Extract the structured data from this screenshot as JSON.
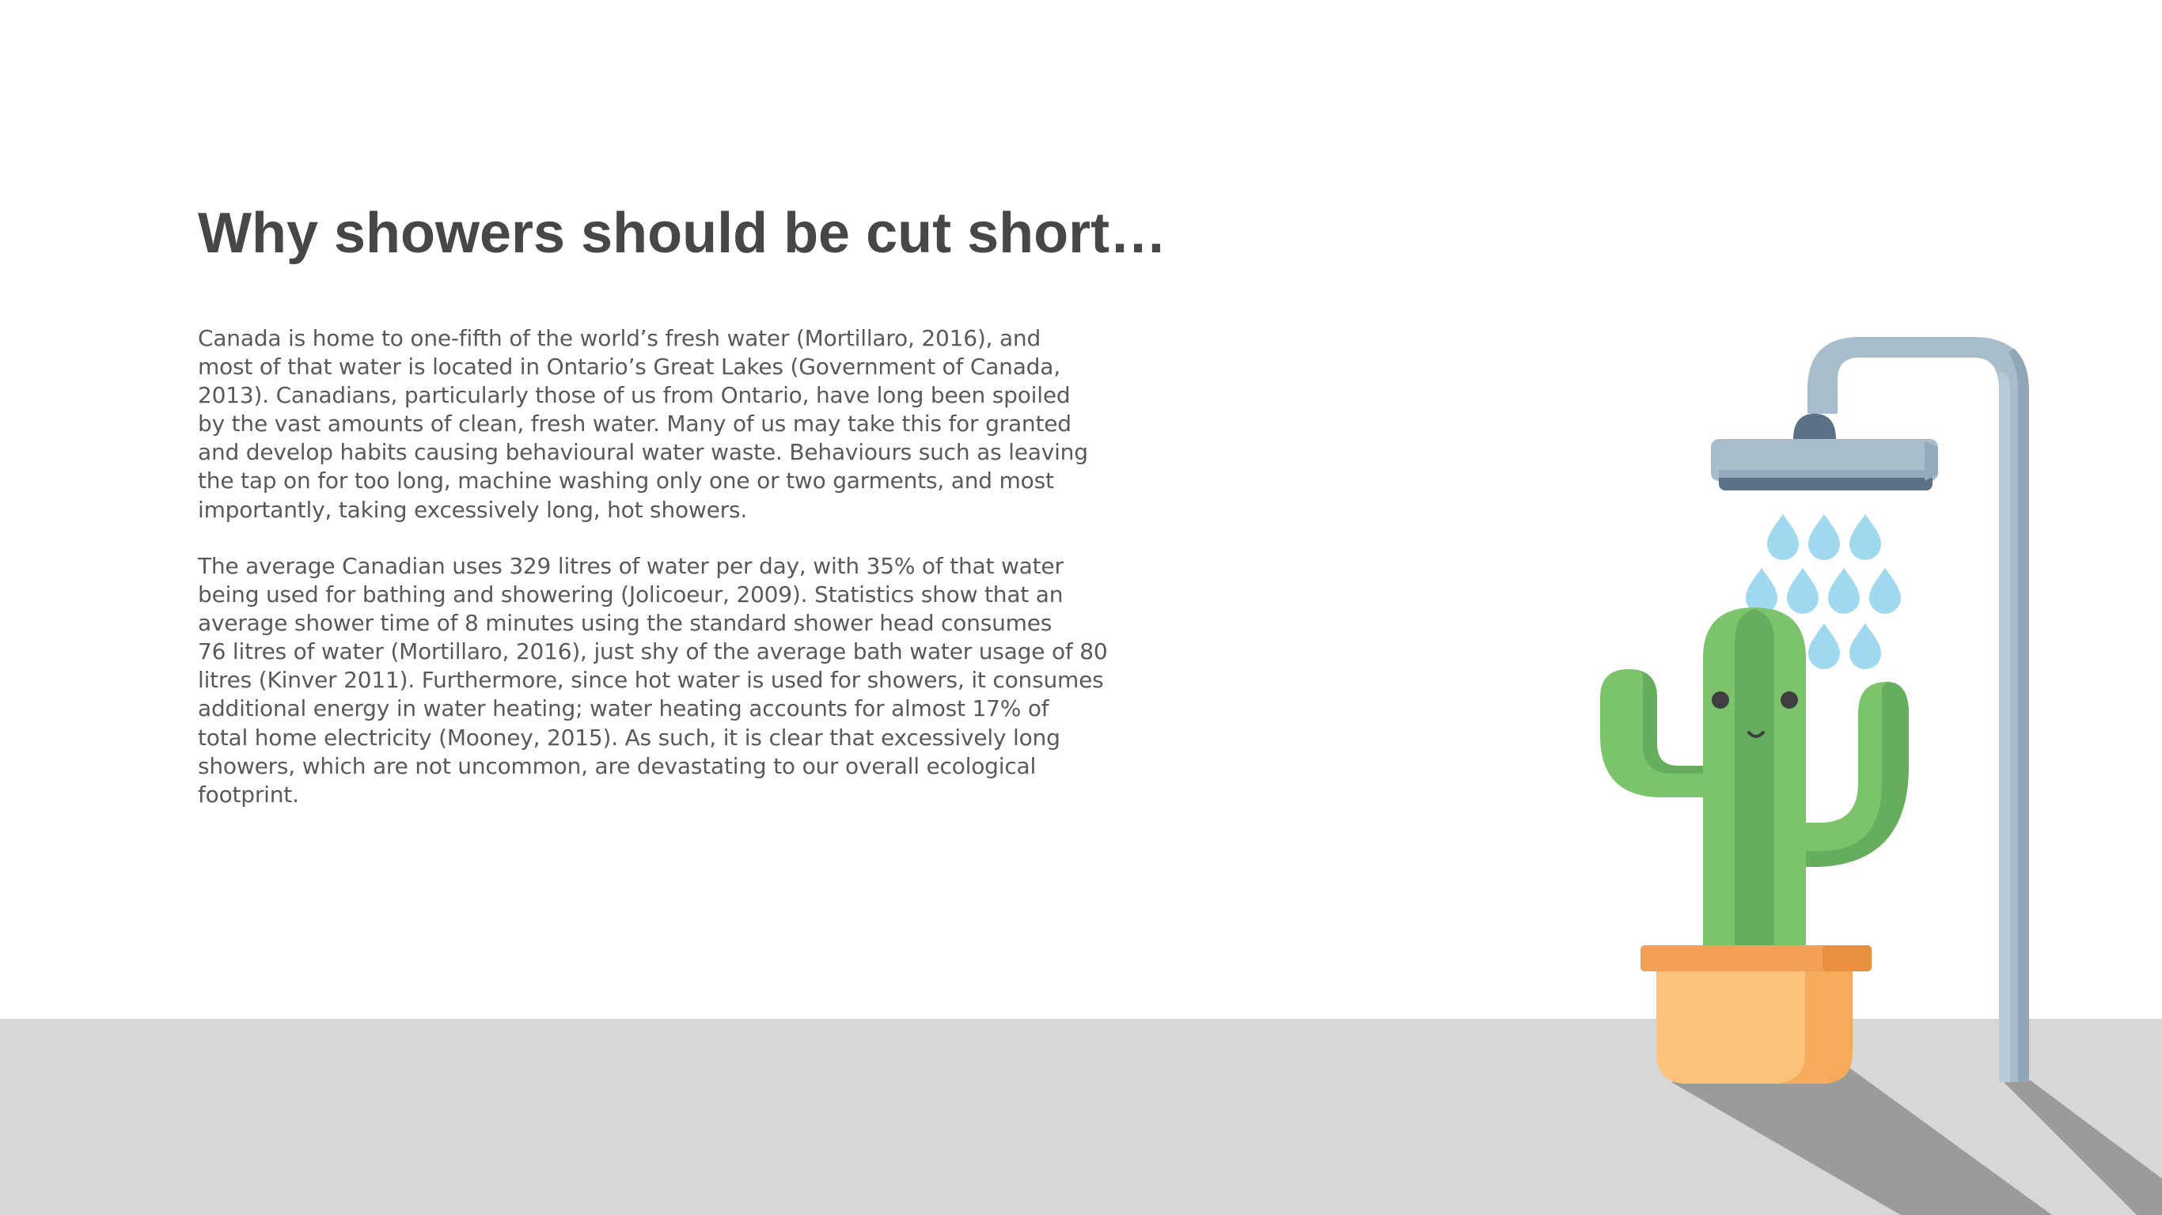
{
  "slide": {
    "title": "Why showers should be cut short…",
    "paragraph_1": [
      "Canada is home to one-fifth of the world’s fresh water (Mortillaro, 2016), and",
      "most of that water is located in Ontario’s Great Lakes (Government of Canada,",
      "2013). Canadians, particularly those of us from Ontario, have long been spoiled",
      "by the vast amounts of clean, fresh water. Many of us may take this for granted",
      "and develop habits causing behavioural water waste. Behaviours such as leaving",
      "the tap on for too long, machine washing only one or two garments, and most",
      "importantly, taking excessively long, hot showers."
    ],
    "paragraph_2": [
      "The average Canadian uses 329 litres of water per day, with 35% of that water",
      "being used for bathing and showering (Jolicoeur, 2009). Statistics show that an",
      "average shower time of 8 minutes using the standard shower head consumes",
      "76 litres of water (Mortillaro, 2016), just shy of the average bath water usage of 80",
      "litres (Kinver 2011). Furthermore, since hot water is used for showers, it consumes",
      "additional energy in water heating; water heating accounts for almost 17% of",
      "total home electricity (Mooney, 2015). As such, it is clear that excessively long",
      "showers, which are not uncommon, are devastating to our overall ecological",
      "footprint."
    ]
  },
  "illustration": {
    "icons": [
      "shower-head-icon",
      "water-drop-icon",
      "cactus-icon",
      "flower-pot-icon"
    ],
    "colors": {
      "background": "#ffffff",
      "floor": "#d7d7d7",
      "shadow": "#9b9b9b",
      "title_text": "#474747",
      "body_text": "#595959",
      "pipe": "#a8bdcc",
      "pipe_dark": "#8fa6b6",
      "shower_head": "#a8bdcc",
      "shower_head_cap": "#5b7286",
      "water_drop": "#9fd8ef",
      "cactus_light": "#7cc46c",
      "cactus_dark": "#66ad5d",
      "cactus_face": "#3f3f3f",
      "pot_rim": "#f1a056",
      "pot_body": "#fcc27c",
      "pot_shade": "#f6ab5a"
    }
  }
}
